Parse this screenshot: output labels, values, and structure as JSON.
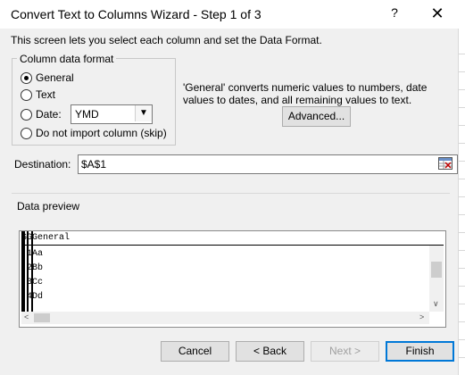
{
  "window": {
    "title": "Convert Text to Columns Wizard - Step 1 of 3",
    "help": "?",
    "close": "✕"
  },
  "intro": "This screen lets you select each column and set the Data Format.",
  "format": {
    "legend": "Column data format",
    "options": [
      "General",
      "Text",
      "Date:",
      "Do not import column (skip)"
    ],
    "selected": "General",
    "date_value": "YMD",
    "explain": "'General' converts numeric values to numbers, date values to dates, and all remaining values to text.",
    "advanced": "Advanced..."
  },
  "destination": {
    "label": "Destination:",
    "value": "$A$1"
  },
  "preview": {
    "label": "Data preview",
    "header": "GGGeneral",
    "lines": [
      "1Aa",
      "2Bb",
      "3Cc",
      "4Dd"
    ]
  },
  "buttons": {
    "cancel": "Cancel",
    "back": "< Back",
    "next": "Next >",
    "finish": "Finish"
  }
}
